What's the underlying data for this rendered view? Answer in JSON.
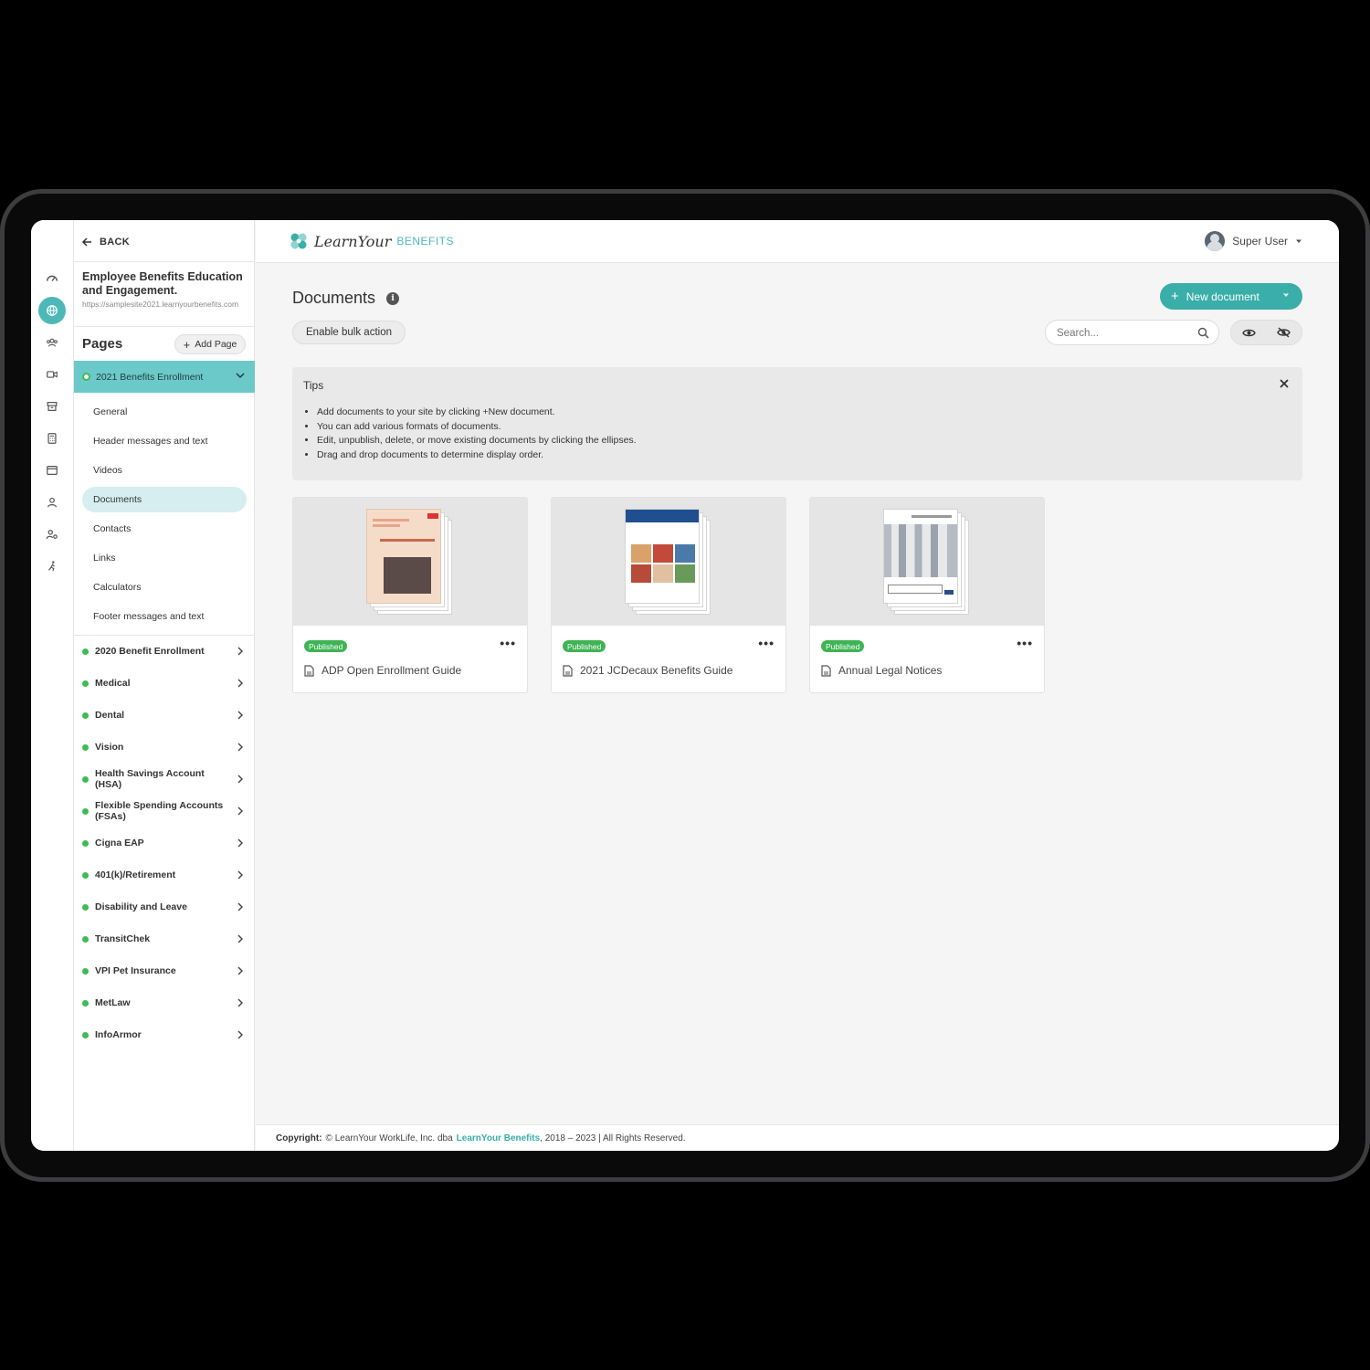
{
  "panel": {
    "back_label": "BACK",
    "site_title": "Employee Benefits Education and Engagement.",
    "site_url": "https://samplesite2021.learnyourbenefits.com",
    "pages_label": "Pages",
    "add_page_label": "Add Page",
    "active_section": "2021 Benefits Enrollment",
    "subitems": [
      "General",
      "Header messages and text",
      "Videos",
      "Documents",
      "Contacts",
      "Links",
      "Calculators",
      "Footer messages and text"
    ],
    "selected_subitem": "Documents",
    "sections": [
      "2020 Benefit Enrollment",
      "Medical",
      "Dental",
      "Vision",
      "Health Savings Account (HSA)",
      "Flexible Spending Accounts (FSAs)",
      "Cigna EAP",
      "401(k)/Retirement",
      "Disability and Leave",
      "TransitChek",
      "VPI Pet Insurance",
      "MetLaw",
      "InfoArmor"
    ]
  },
  "header": {
    "logo_script": "LearnYour",
    "logo_caps": "BENEFITS",
    "user_name": "Super User"
  },
  "main": {
    "title": "Documents",
    "new_document_label": "New document",
    "bulk_action_label": "Enable bulk action",
    "search_placeholder": "Search...",
    "tips": {
      "title": "Tips",
      "items": [
        "Add documents to your site by clicking +New document.",
        "You can add various formats of documents.",
        "Edit, unpublish, delete, or move existing documents by clicking the ellipses.",
        "Drag and drop documents to determine display order."
      ]
    },
    "documents": [
      {
        "status": "Published",
        "title": "ADP Open Enrollment Guide"
      },
      {
        "status": "Published",
        "title": "2021 JCDecaux Benefits Guide"
      },
      {
        "status": "Published",
        "title": "Annual Legal Notices"
      }
    ]
  },
  "footer": {
    "label": "Copyright:",
    "prefix": "© LearnYour WorkLife, Inc. dba",
    "brand": "LearnYour Benefits",
    "suffix": ", 2018 – 2023 | All Rights Reserved."
  },
  "colors": {
    "accent": "#3aaea8",
    "active_section": "#6cc9c9",
    "published": "#3fb454"
  }
}
